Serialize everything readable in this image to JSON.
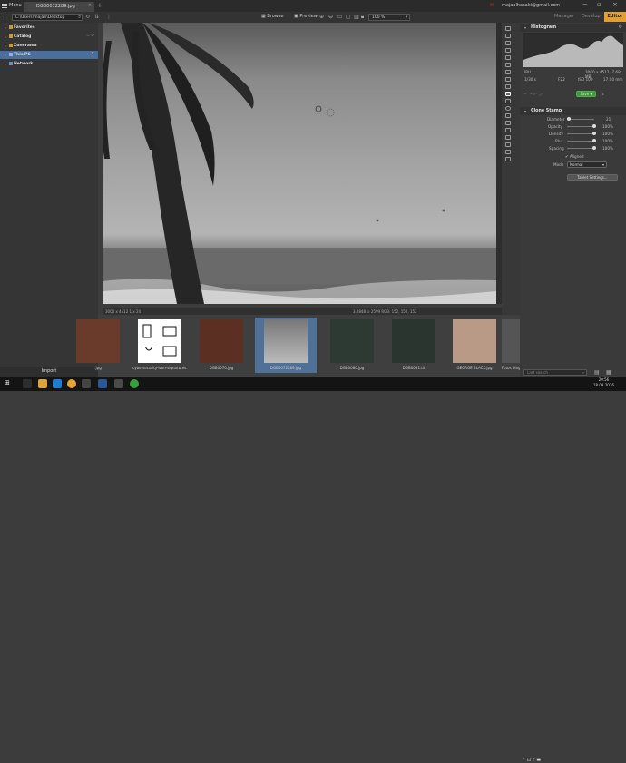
{
  "titlebar": {
    "menu_label": "Menu",
    "tab_title": "DGB0072289.jpg",
    "plus": "+",
    "email": "majaalhasaki@gmail.com",
    "win_min": "−",
    "win_max": "▫",
    "win_close": "×"
  },
  "toolbar": {
    "path": "C:\\Users\\majan\\Desktop",
    "browse_label": "Browse",
    "preview_label": "Preview",
    "zoom_value": "100 %",
    "manager_label": "Manager",
    "develop_label": "Develop",
    "editor_label": "Editor"
  },
  "sidebar": {
    "items": [
      {
        "label": "Favorites"
      },
      {
        "label": "Catalog"
      },
      {
        "label": "Zonerama"
      },
      {
        "label": "This PC"
      },
      {
        "label": "Network"
      }
    ],
    "import_label": "Import"
  },
  "image_status": {
    "left": "3000 x 4512 1 x 24",
    "right": "3,2848 ⊙ 2599   RGB: 152, 152, 152"
  },
  "filmstrip": {
    "items": [
      {
        "label": ".jpg"
      },
      {
        "label": "cybersecurity-icon-signatures.png"
      },
      {
        "label": "DGB0070.jpg"
      },
      {
        "label": "DGB0072289.jpg"
      },
      {
        "label": "DGB0080.jpg"
      },
      {
        "label": "DGB0081.tif"
      },
      {
        "label": "GEORGE BLACK.jpg"
      },
      {
        "label": "Fotos bing"
      }
    ]
  },
  "histogram": {
    "title": "Histogram",
    "info_row1_left": "IPU",
    "info_row1_right": "3000 x 4512 (7.68 MB)",
    "info_row2": [
      "1/30 s",
      "F22",
      "ISO 100",
      "17.00 mm"
    ],
    "save_label": "Save"
  },
  "clone_stamp": {
    "title": "Clone Stamp",
    "diameter_label": "Diameter",
    "diameter_value": "21",
    "diameter_level": 0.07,
    "opacity_label": "Opacity",
    "opacity_value": "100%",
    "opacity_level": 1.0,
    "density_label": "Density",
    "density_value": "100%",
    "density_level": 1.0,
    "blur_label": "Blur",
    "blur_value": "100%",
    "blur_level": 1.0,
    "spacing_label": "Spacing",
    "spacing_value": "100%",
    "spacing_level": 1.0,
    "aligned_label": "Aligned",
    "mode_label": "Mode",
    "mode_value": "Normal",
    "tablet_settings_label": "Tablet Settings..."
  },
  "search": {
    "placeholder": "Last search"
  },
  "clock": {
    "time": "20:56",
    "date": "18.03.2016"
  },
  "colors": {
    "accent": "#e3a02d",
    "selection": "#4a6f9c",
    "save_green": "#3f9a3a"
  }
}
